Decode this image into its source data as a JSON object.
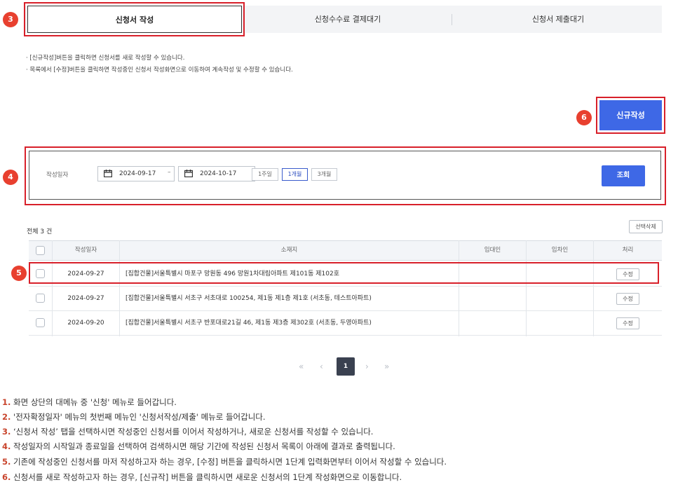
{
  "markers": {
    "m3": "3",
    "m4": "4",
    "m5": "5",
    "m6": "6"
  },
  "tabs": [
    {
      "label": "신청서 작성"
    },
    {
      "label": "신청수수료 결제대기"
    },
    {
      "label": "신청서 제출대기"
    }
  ],
  "info": [
    "· [신규작성]버튼을 클릭하면 신청서를 새로 작성할 수 있습니다.",
    "· 목록에서 [수정]버튼을 클릭하면 작성중인 신청서 작성화면으로 이동하여 계속작성 및 수정할 수 있습니다."
  ],
  "new_button": "신규작성",
  "search": {
    "label": "작성일자",
    "start_date": "2024-09-17",
    "separator": "–",
    "end_date": "2024-10-17",
    "periods": [
      "1주일",
      "1개월",
      "3개월"
    ],
    "selected_period": "1개월",
    "search_button": "조회"
  },
  "list": {
    "total_text": "전체  3  건",
    "delete_selected": "선택삭제",
    "headers": [
      "작성일자",
      "소재지",
      "임대인",
      "임차인",
      "처리"
    ],
    "rows": [
      {
        "date": "2024-09-27",
        "address": "[집합건물]서울특별시 마포구 망원동 496 망원1차대림아파트 제101동 제102호",
        "landlord": "",
        "tenant": "",
        "action": "수정"
      },
      {
        "date": "2024-09-27",
        "address": "[집합건물]서울특별시 서초구 서초대로 100254, 제1동 제1층 제1호 (서초동, 테스트아파트)",
        "landlord": "",
        "tenant": "",
        "action": "수정"
      },
      {
        "date": "2024-09-20",
        "address": "[집합건물]서울특별시 서초구 반포대로21길 46, 제1동 제3층 제302호 (서초동, 두영아파트)",
        "landlord": "",
        "tenant": "",
        "action": "수정"
      }
    ]
  },
  "pagination": {
    "first": "«",
    "prev": "‹",
    "current": "1",
    "next": "›",
    "last": "»"
  },
  "notes": [
    {
      "num": "1.",
      "text": " 화면 상단의 대메뉴 중 '신청' 메뉴로 들어갑니다."
    },
    {
      "num": "2.",
      "text": " '전자확정일자' 메뉴의 첫번째 메뉴인 '신청서작성/제출' 메뉴로 들어갑니다."
    },
    {
      "num": "3.",
      "text": " ‘신청서 작성’ 탭을 선택하시면 작성중인 신청서를 이어서 작성하거나, 새로운 신청서를 작성할 수 있습니다."
    },
    {
      "num": "4.",
      "text": " 작성일자의 시작일과 종료일을 선택하여 검색하시면 해당 기간에 작성된 신청서 목록이 아래에 결과로 출력됩니다."
    },
    {
      "num": "5.",
      "text": " 기존에 작성중인 신청서를 마저 작성하고자 하는 경우, [수정] 버튼을 클릭하시면 1단계 입력화면부터 이어서 작성할 수 있습니다."
    },
    {
      "num": "6.",
      "text": " 신청서를 새로 작성하고자 하는 경우, [신규작] 버튼을 클릭하시면 새로운 신청서의 1단계 작성화면으로 이동합니다."
    }
  ],
  "colors": {
    "accent": "#3e68e6",
    "highlight": "#d8202a",
    "marker": "#e8402f",
    "note_number": "#c8442c"
  }
}
